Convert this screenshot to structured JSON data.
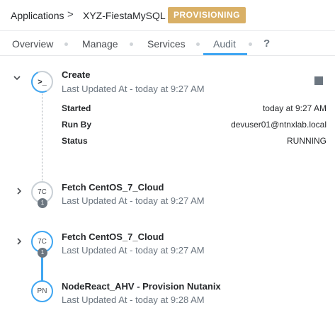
{
  "breadcrumb": {
    "root": "Applications",
    "separator": ">",
    "app_name": "XYZ-FiestaMySQL",
    "status_badge": "PROVISIONING"
  },
  "tabs": [
    {
      "label": "Overview",
      "active": false
    },
    {
      "label": "Manage",
      "active": false
    },
    {
      "label": "Services",
      "active": false
    },
    {
      "label": "Audit",
      "active": true
    }
  ],
  "help_label": "?",
  "timeline": {
    "create": {
      "icon_text": ">_",
      "title": "Create",
      "subtitle": "Last Updated At - today at 9:27 AM",
      "details": [
        {
          "label": "Started",
          "value": "today at 9:27 AM"
        },
        {
          "label": "Run By",
          "value": "devuser01@ntnxlab.local"
        },
        {
          "label": "Status",
          "value": "RUNNING"
        }
      ]
    },
    "task1": {
      "icon_text": "7C",
      "count": "1",
      "title": "Fetch CentOS_7_Cloud",
      "subtitle": "Last Updated At - today at 9:27 AM"
    },
    "task2": {
      "icon_text": "7C",
      "count": "1",
      "title": "Fetch CentOS_7_Cloud",
      "subtitle": "Last Updated At - today at 9:27 AM"
    },
    "task3": {
      "icon_text": "PN",
      "title": "NodeReact_AHV - Provision Nutanix",
      "subtitle": "Last Updated At - today at 9:28 AM"
    }
  },
  "colors": {
    "accent": "#3fa6f2",
    "badge": "#d9b066",
    "muted": "#6c7680"
  },
  "icons": {
    "collapse": "chevron-down-icon",
    "expand": "chevron-right-icon",
    "stop": "stop-icon"
  }
}
